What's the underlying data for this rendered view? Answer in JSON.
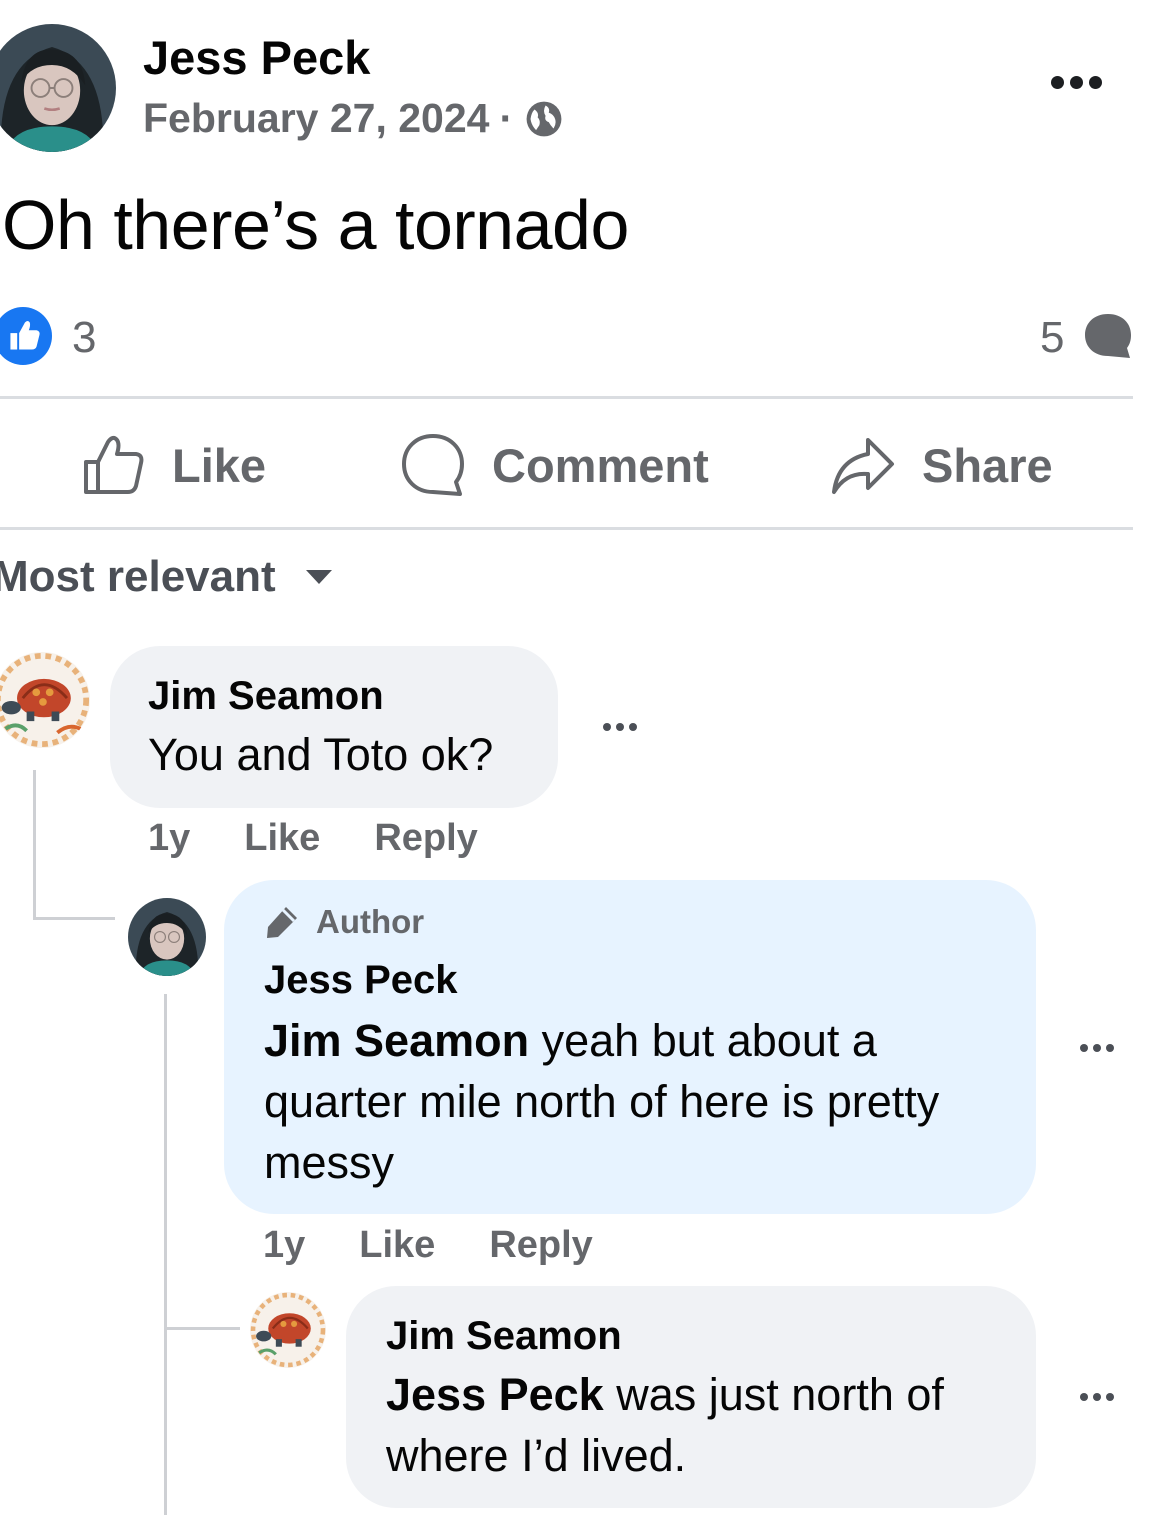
{
  "post": {
    "author": "Jess Peck",
    "date": "February 27, 2024",
    "separator": "·",
    "privacy_icon": "globe-icon",
    "text": "Oh there’s a tornado",
    "reaction_count": "3",
    "comment_count": "5"
  },
  "actions": {
    "like": "Like",
    "comment": "Comment",
    "share": "Share"
  },
  "sort": {
    "label": "Most relevant"
  },
  "comments": [
    {
      "name": "Jim Seamon",
      "text": "You and Toto ok?",
      "age": "1y",
      "like": "Like",
      "reply": "Reply"
    },
    {
      "badge": "Author",
      "name": "Jess Peck",
      "mention": "Jim Seamon",
      "text": " yeah but about a quarter mile north of here is pretty messy",
      "age": "1y",
      "like": "Like",
      "reply": "Reply"
    },
    {
      "name": "Jim Seamon",
      "mention": "Jess Peck",
      "text": " was just north of where I’d lived."
    }
  ],
  "colors": {
    "facebook_blue": "#1877f2",
    "secondary_text": "#65676b",
    "comment_bubble": "#f0f2f5",
    "author_bubble": "#e7f3ff"
  }
}
